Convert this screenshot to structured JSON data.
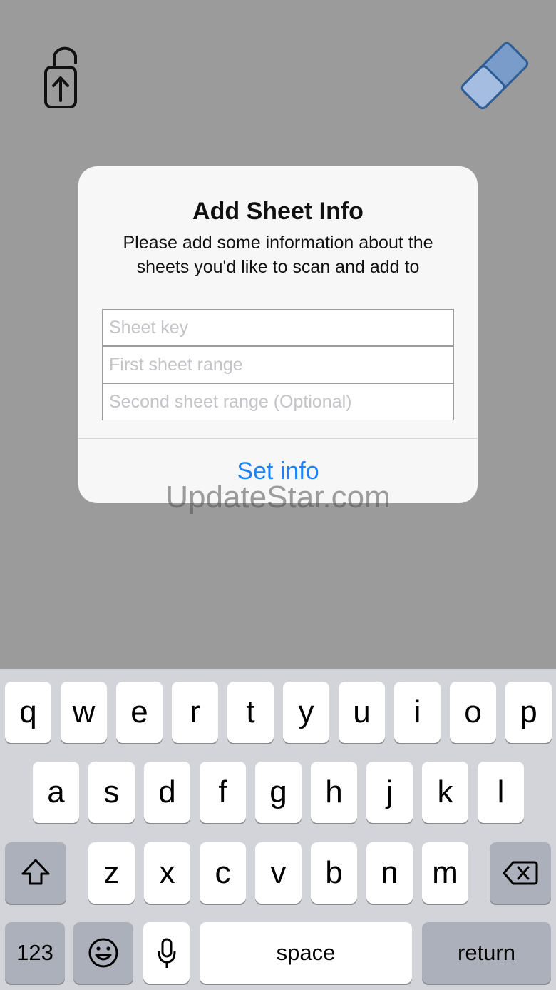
{
  "toolbar": {
    "left_icon": "door-hanger-signout-icon",
    "right_icon": "eraser-icon",
    "eraser_color": "#6b93c8"
  },
  "alert": {
    "title": "Add Sheet Info",
    "message_line1": "Please add some information about the",
    "message_line2": "sheets you'd like to scan and add to",
    "fields": [
      {
        "placeholder": "Sheet key",
        "value": ""
      },
      {
        "placeholder": "First sheet range",
        "value": ""
      },
      {
        "placeholder": "Second sheet range (Optional)",
        "value": ""
      }
    ],
    "action_label": "Set info",
    "action_color": "#1a82fb"
  },
  "watermark": "UpdateStar.com",
  "keyboard": {
    "row1": [
      "q",
      "w",
      "e",
      "r",
      "t",
      "y",
      "u",
      "i",
      "o",
      "p"
    ],
    "row2": [
      "a",
      "s",
      "d",
      "f",
      "g",
      "h",
      "j",
      "k",
      "l"
    ],
    "row3": [
      "z",
      "x",
      "c",
      "v",
      "b",
      "n",
      "m"
    ],
    "shift_icon": "shift-icon",
    "delete_icon": "backspace-icon",
    "numbers_label": "123",
    "emoji_icon": "emoji-icon",
    "mic_icon": "microphone-icon",
    "space_label": "space",
    "return_label": "return"
  }
}
